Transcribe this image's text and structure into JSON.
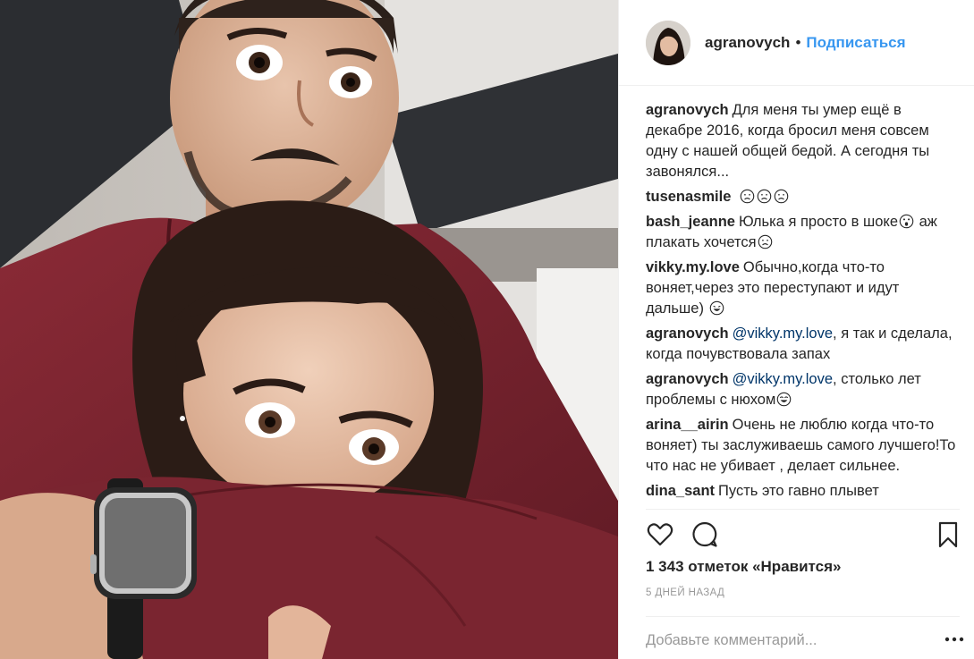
{
  "post": {
    "username": "agranovych",
    "separator": "•",
    "follow_label": "Подписаться"
  },
  "comments": [
    {
      "user": "agranovych",
      "text": "Для меня ты умер ещё в декабре 2016, когда бросил меня совсем одну с нашей общей бедой. А сегодня ты завонялся..."
    },
    {
      "user": "tusenasmile",
      "emoji": [
        "sad-face",
        "sad-face",
        "sad-face"
      ]
    },
    {
      "user": "bash_jeanne",
      "text": "Юлька я просто в шоке",
      "emoji1": "shocked-face",
      "text2": " аж плакать хочется",
      "emoji2": "sad-face"
    },
    {
      "user": "vikky.my.love",
      "text": "Обычно,когда что-то воняет,через это переступают и идут дальше)",
      "emoji": "grin-face"
    },
    {
      "user": "agranovych",
      "mention": "@vikky.my.love",
      "text": ", я так и сделала, когда почувствовала запах"
    },
    {
      "user": "agranovych",
      "mention": "@vikky.my.love",
      "text": ", столько лет проблемы с нюхом",
      "emoji": "laugh-face"
    },
    {
      "user": "arina__airin",
      "text": "Очень не люблю когда что-то воняет) ты заслуживаешь самого лучшего!То что нас не убивает , делает сильнее."
    },
    {
      "user": "dina_sant",
      "text": "Пусть это гавно плывет"
    }
  ],
  "actions": {
    "like_icon": "heart-outline-icon",
    "comment_icon": "speech-bubble-icon",
    "save_icon": "bookmark-icon"
  },
  "likes_text": "1 343 отметок «Нравится»",
  "date_text": "5 ДНЕЙ НАЗАД",
  "add_comment_placeholder": "Добавьте комментарий...",
  "colors": {
    "link_blue": "#3897f0",
    "mention_blue": "#003569",
    "text": "#262626",
    "muted": "#999999",
    "sweater": "#7a2530"
  }
}
